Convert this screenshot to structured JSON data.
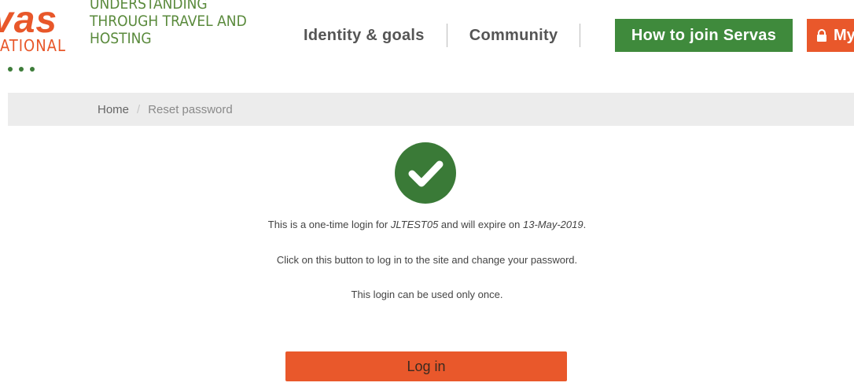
{
  "logo": {
    "word": "vas",
    "sub": "ATIONAL",
    "tagline": [
      "UNDERSTANDING",
      "THROUGH TRAVEL AND",
      "HOSTING"
    ]
  },
  "nav": {
    "identity": "Identity & goals",
    "community": "Community",
    "join": "How to join Servas",
    "my": "My"
  },
  "breadcrumb": {
    "home": "Home",
    "separator": "/",
    "current": "Reset password"
  },
  "main": {
    "line1_prefix": "This is a one-time login for ",
    "line1_user": "JLTEST05",
    "line1_middle": " and will expire on ",
    "line1_date": "13-May-2019",
    "line1_suffix": ".",
    "line2": "Click on this button to log in to the site and change your password.",
    "line3": "This login can be used only once.",
    "login_button": "Log in"
  },
  "colors": {
    "green": "#3f8a3c",
    "orange": "#e9582b",
    "breadcrumb_bg": "#ececec"
  }
}
